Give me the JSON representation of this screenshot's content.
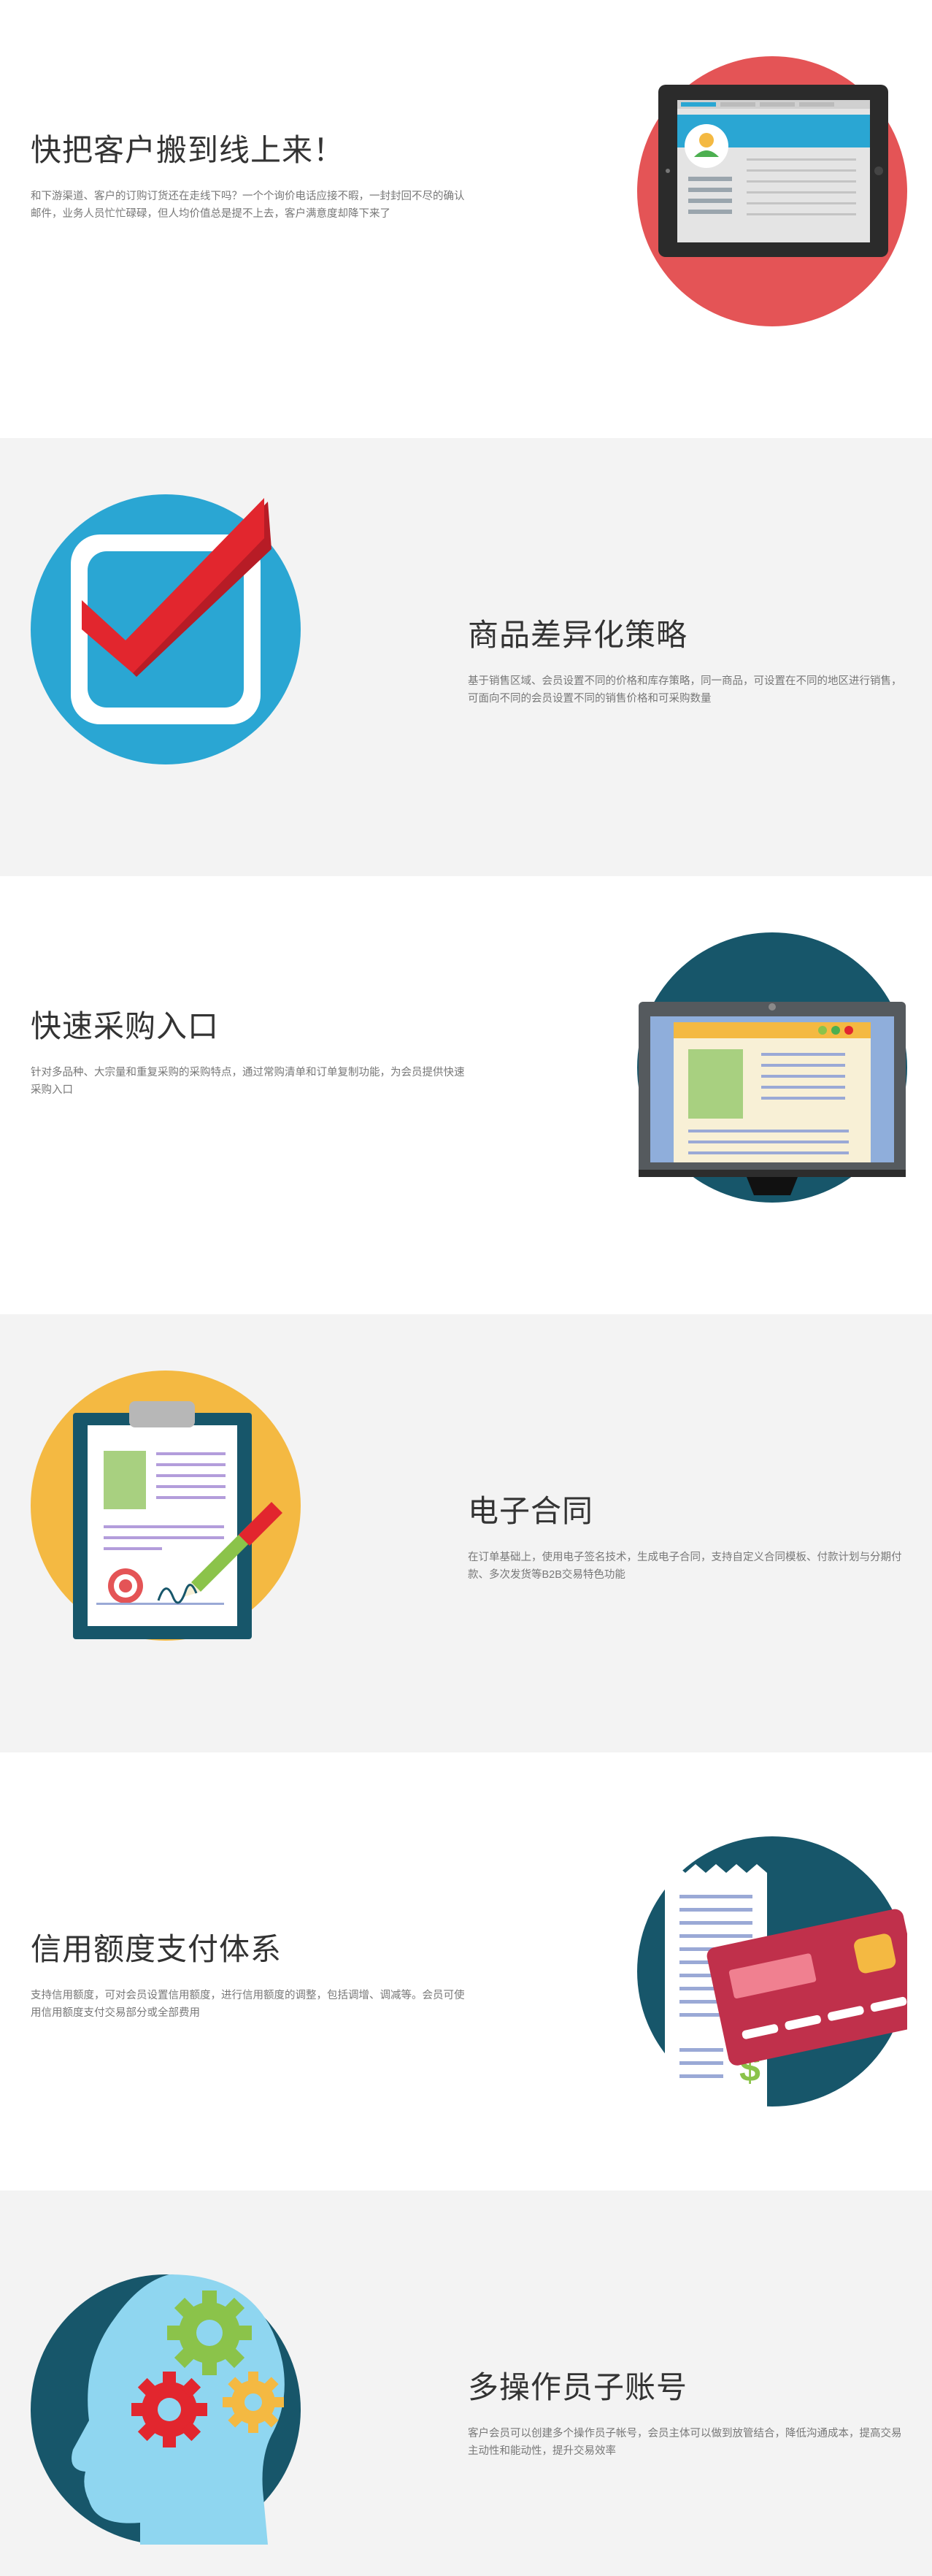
{
  "sections": [
    {
      "title": "快把客户搬到线上来！",
      "desc": "和下游渠道、客户的订购订货还在走线下吗？一个个询价电话应接不暇，一封封回不尽的确认邮件，业务人员忙忙碌碌，但人均价值总是提不上去，客户满意度却降下来了",
      "icon": "tablet-icon",
      "color": "#e45456"
    },
    {
      "title": "商品差异化策略",
      "desc": "基于销售区域、会员设置不同的价格和库存策略，同一商品，可设置在不同的地区进行销售，可面向不同的会员设置不同的销售价格和可采购数量",
      "icon": "checkbox-checkmark-icon",
      "color": "#2aa6d3"
    },
    {
      "title": "快速采购入口",
      "desc": "针对多品种、大宗量和重复采购的采购特点，通过常购清单和订单复制功能，为会员提供快速采购入口",
      "icon": "monitor-icon",
      "color": "#17566a"
    },
    {
      "title": "电子合同",
      "desc": "在订单基础上，使用电子签名技术，生成电子合同，支持自定义合同模板、付款计划与分期付款、多次发货等B2B交易特色功能",
      "icon": "clipboard-contract-icon",
      "color": "#f4b942"
    },
    {
      "title": "信用额度支付体系",
      "desc": "支持信用额度，可对会员设置信用额度，进行信用额度的调整，包括调增、调减等。会员可使用信用额度支付交易部分或全部费用",
      "icon": "credit-card-receipt-icon",
      "color": "#17566a"
    },
    {
      "title": "多操作员子账号",
      "desc": "客户会员可以创建多个操作员子帐号，会员主体可以做到放管结合，降低沟通成本，提高交易主动性和能动性，提升交易效率",
      "icon": "head-gears-icon",
      "color": "#17566a"
    }
  ]
}
